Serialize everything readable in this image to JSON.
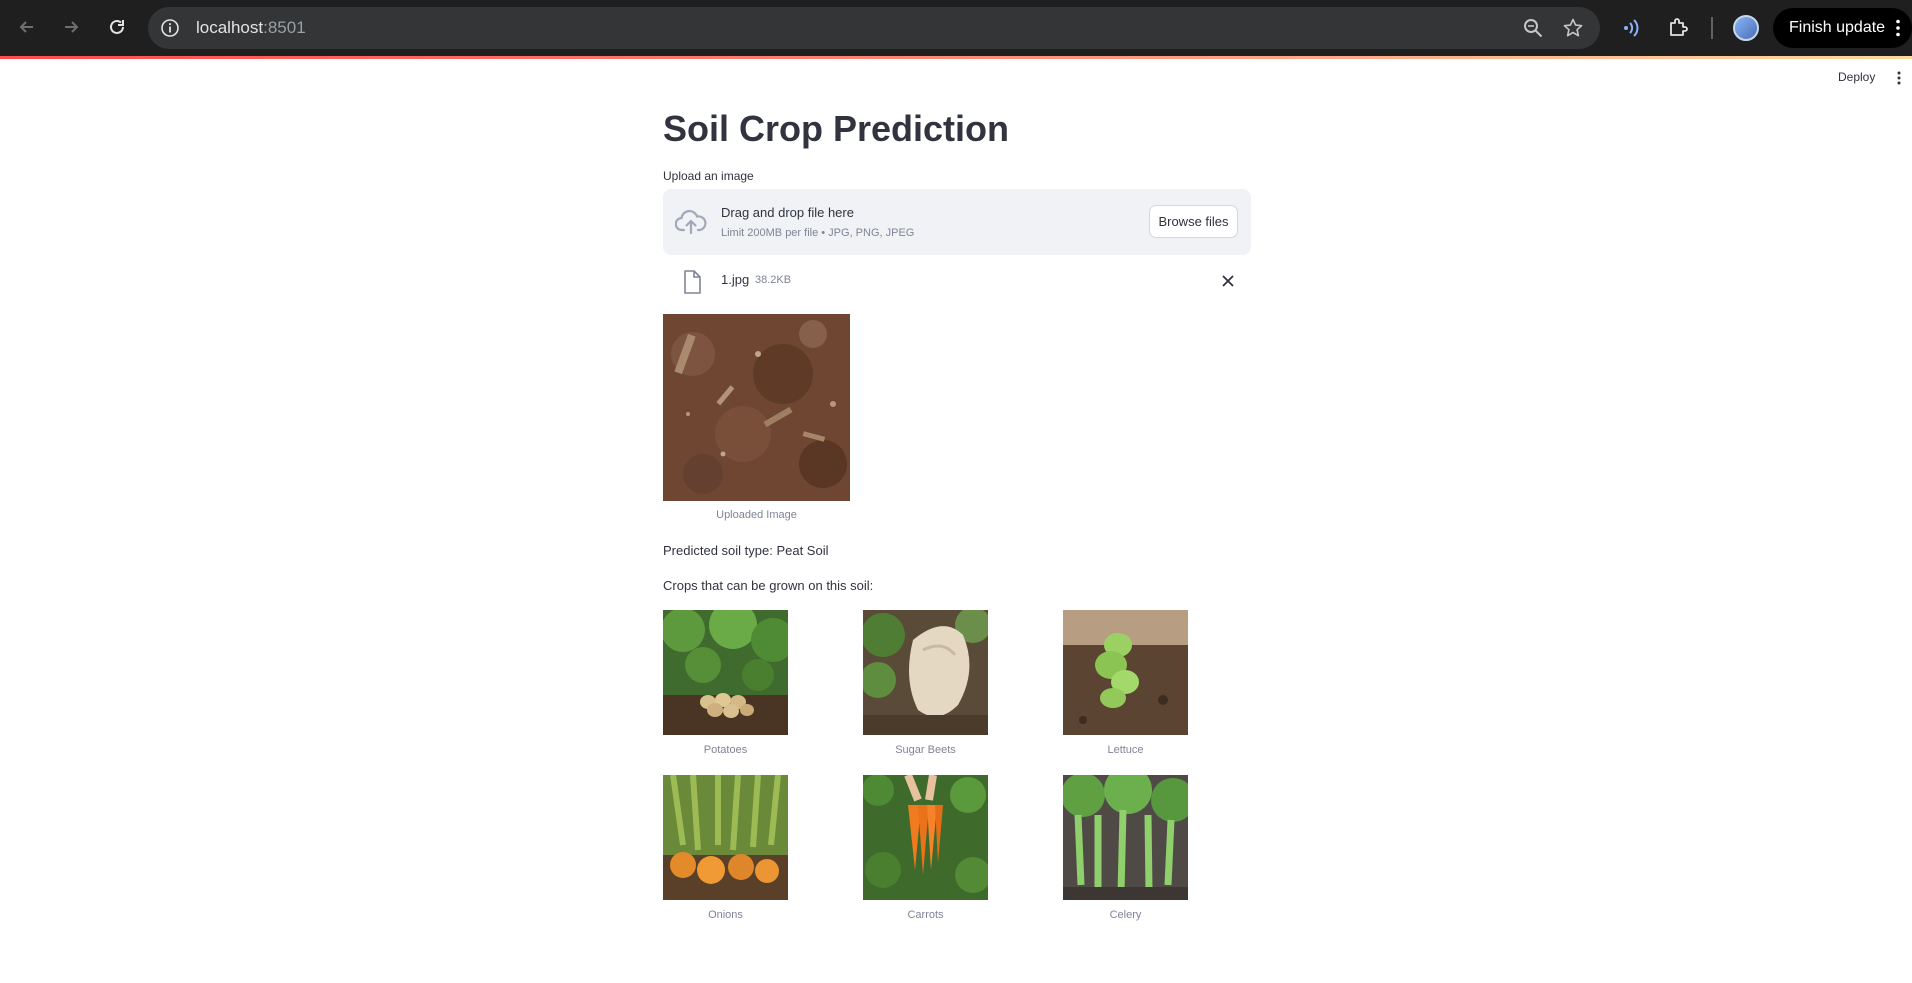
{
  "browser": {
    "url_host": "localhost",
    "url_port": ":8501",
    "finish_update_label": "Finish update"
  },
  "header": {
    "deploy_label": "Deploy"
  },
  "page": {
    "title": "Soil Crop Prediction",
    "upload_label": "Upload an image",
    "dropzone": {
      "title": "Drag and drop file here",
      "subtitle": "Limit 200MB per file • JPG, PNG, JPEG",
      "browse_label": "Browse files"
    },
    "uploaded_file": {
      "name": "1.jpg",
      "size": "38.2KB"
    },
    "uploaded_caption": "Uploaded Image",
    "prediction_text": "Predicted soil type: Peat Soil",
    "crops_heading": "Crops that can be grown on this soil:",
    "crops": [
      {
        "name": "Potatoes"
      },
      {
        "name": "Sugar Beets"
      },
      {
        "name": "Lettuce"
      },
      {
        "name": "Onions"
      },
      {
        "name": "Carrots"
      },
      {
        "name": "Celery"
      }
    ]
  },
  "colors": {
    "accent": "#ff4b4b",
    "text": "#31333f",
    "muted": "#808495",
    "dropzone_bg": "#f0f2f6"
  }
}
